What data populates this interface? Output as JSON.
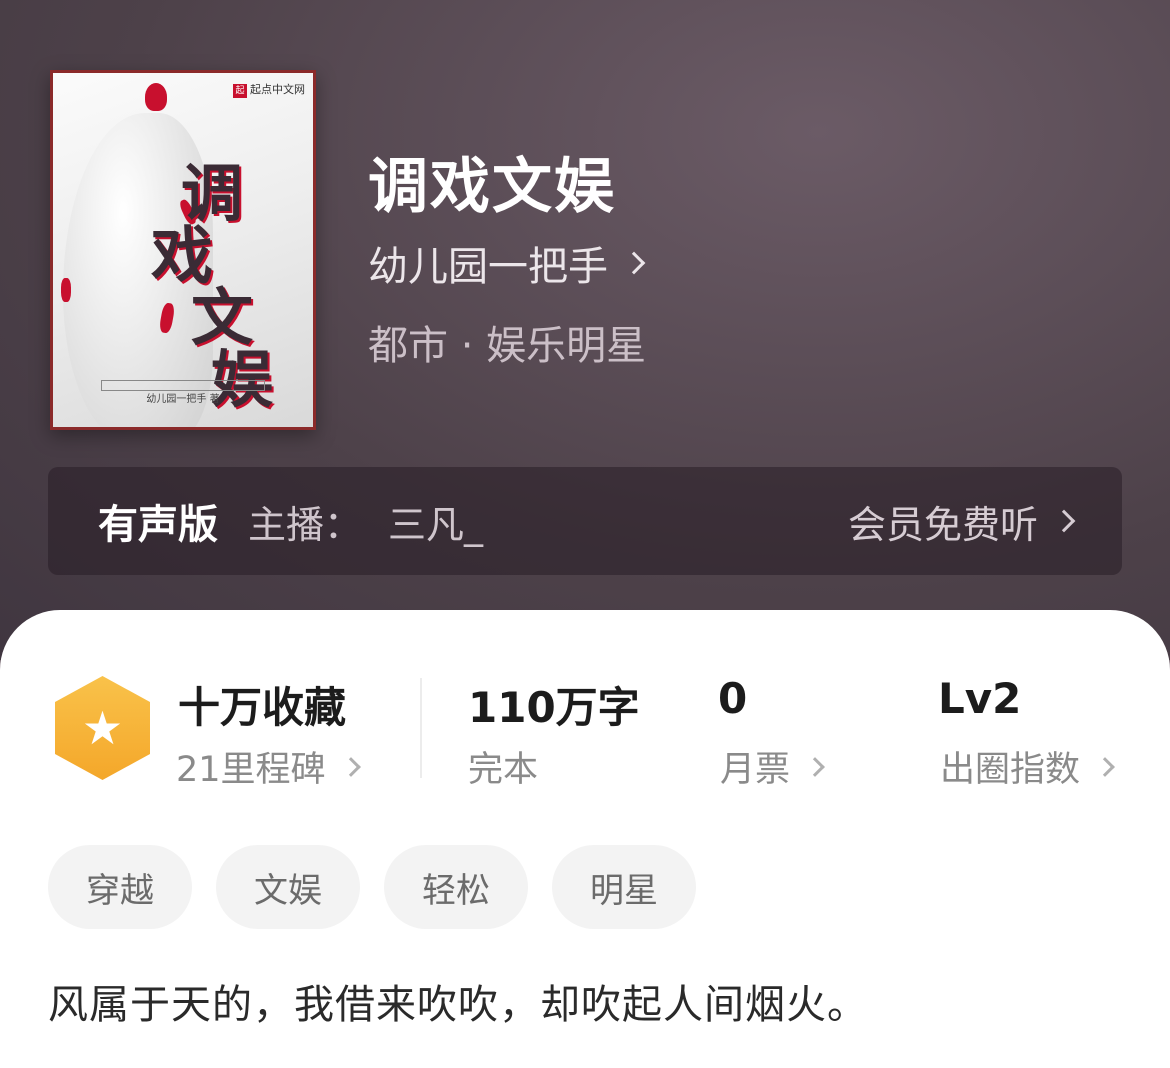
{
  "book": {
    "title": "调戏文娱",
    "author": "幼儿园一把手",
    "category": "都市 · 娱乐明星",
    "cover": {
      "title_chars": [
        "调",
        "戏",
        "文",
        "娱"
      ],
      "publisher": "起点中文网",
      "publisher_badge": "起",
      "author_line": "幼儿园一把手 著"
    }
  },
  "audio": {
    "title": "有声版",
    "host_label": "主播：",
    "host_name": "三凡_",
    "cta": "会员免费听"
  },
  "stats": {
    "collect_main": "十万收藏",
    "collect_sub": "21里程碑",
    "words_main": "110万字",
    "words_sub": "完本",
    "tickets_main": "0",
    "tickets_sub": "月票",
    "popularity_main": "Lv2",
    "popularity_sub": "出圈指数"
  },
  "tags": [
    "穿越",
    "文娱",
    "轻松",
    "明星"
  ],
  "intro": "风属于天的，我借来吹吹，却吹起人间烟火。",
  "icons": {
    "badge": "star-hexagon-icon",
    "chevron": "chevron-right-icon"
  },
  "colors": {
    "badge_gold": "#f4a72a",
    "lip_red": "#c8102e"
  }
}
